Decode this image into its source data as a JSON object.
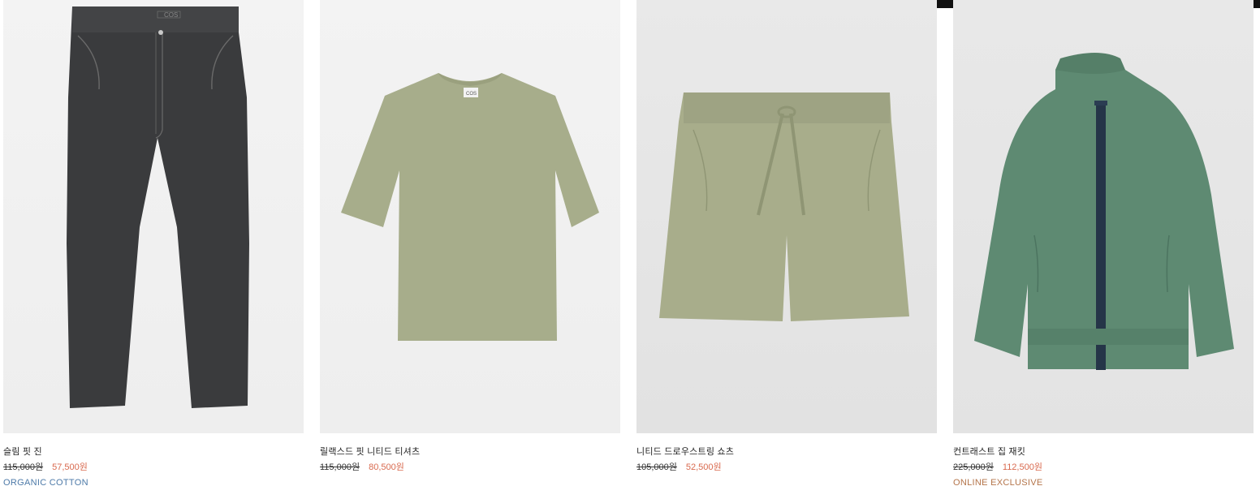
{
  "products": [
    {
      "name": "슬림 핏 진",
      "original_price": "115,000원",
      "sale_price": "57,500원",
      "badge": "ORGANIC COTTON",
      "badge_color": "#4d7aa8",
      "image_icon": "jeans-image"
    },
    {
      "name": "릴랙스드 핏 니티드 티셔츠",
      "original_price": "115,000원",
      "sale_price": "80,500원",
      "badge": "",
      "badge_color": "",
      "image_icon": "tshirt-image"
    },
    {
      "name": "니티드 드로우스트링 쇼츠",
      "original_price": "105,000원",
      "sale_price": "52,500원",
      "badge": "",
      "badge_color": "",
      "image_icon": "shorts-image"
    },
    {
      "name": "컨트래스트 집 재킷",
      "original_price": "225,000원",
      "sale_price": "112,500원",
      "badge": "ONLINE EXCLUSIVE",
      "badge_color": "#b4744a",
      "image_icon": "jacket-image"
    }
  ],
  "colors": {
    "sale": "#d96a4f",
    "strikethrough": "#333333"
  }
}
